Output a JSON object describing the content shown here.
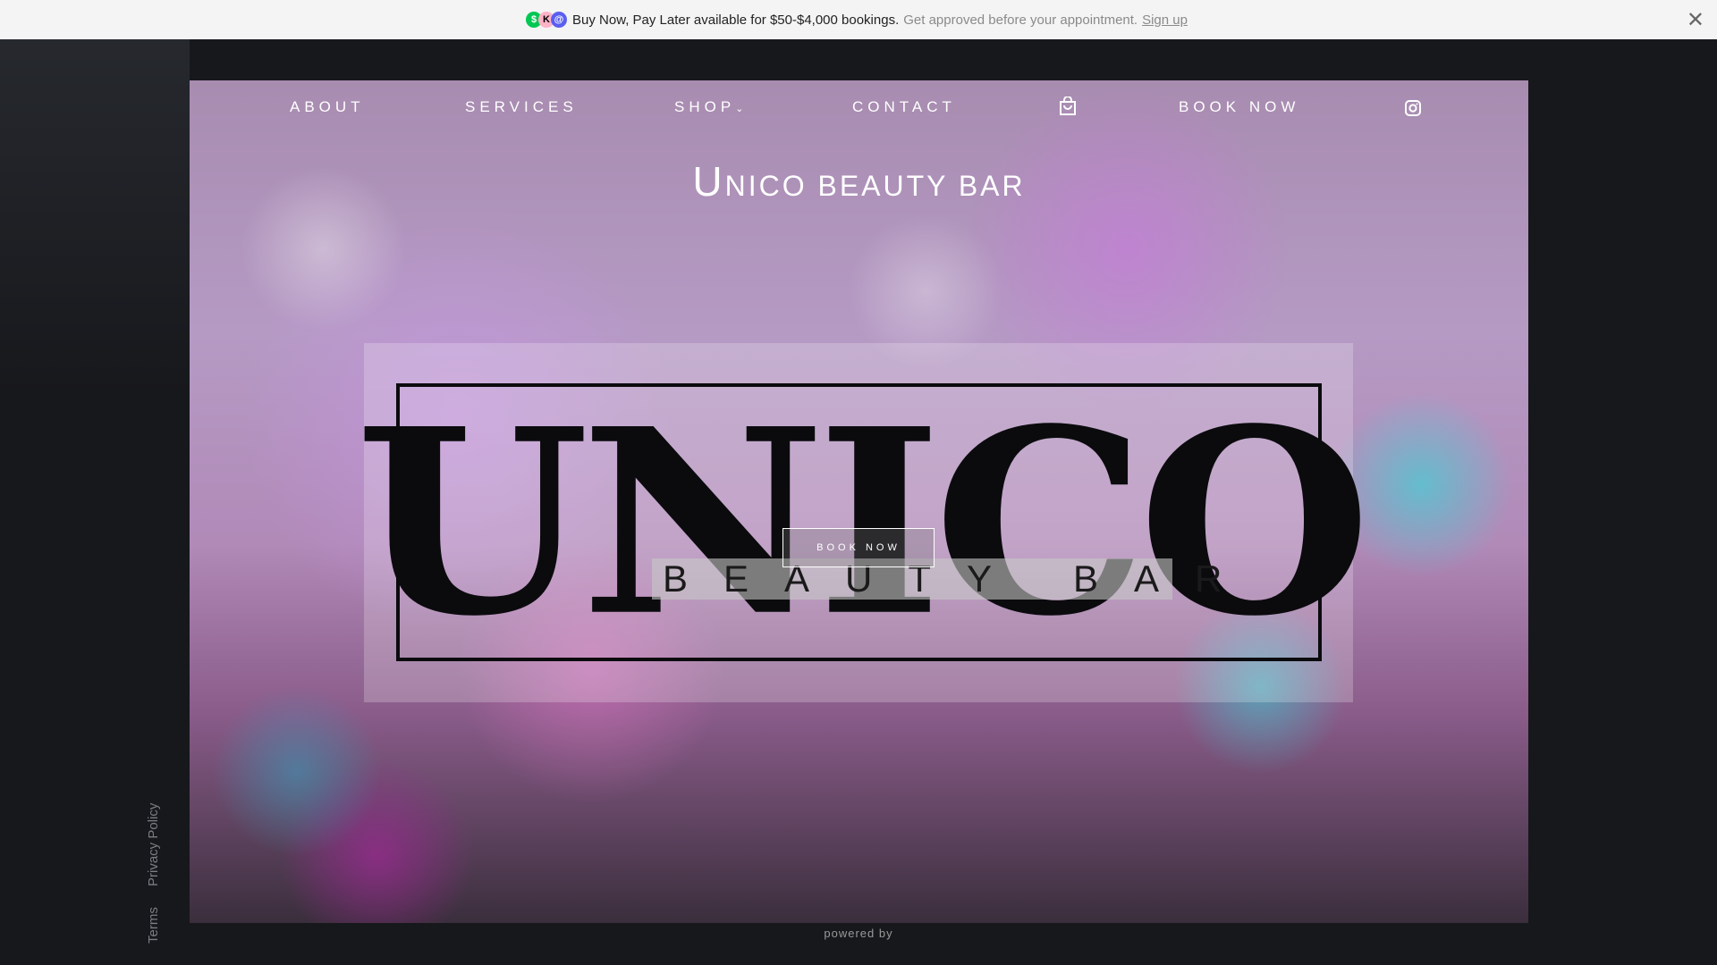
{
  "banner": {
    "text": "Buy Now, Pay Later available for $50-$4,000 bookings.",
    "subtext": "Get approved before your appointment.",
    "link": "Sign up",
    "icons": [
      {
        "glyph": "$",
        "color": "#00c853"
      },
      {
        "glyph": "K",
        "color": "#ffb3c7"
      },
      {
        "glyph": "@",
        "color": "#5a5ff0"
      }
    ],
    "close": "✕"
  },
  "nav": {
    "about": "ABOUT",
    "services": "SERVICES",
    "shop": "SHOP",
    "contact": "CONTACT",
    "book": "BOOK NOW"
  },
  "hero": {
    "title_initial": "U",
    "title_rest": "NICO BEAUTY BAR",
    "logo_main": "UNICO",
    "logo_sub": "BEAUTY BAR",
    "book_button": "BOOK NOW"
  },
  "footer": {
    "privacy": "Privacy Policy",
    "terms": "Terms",
    "powered": "powered by"
  }
}
